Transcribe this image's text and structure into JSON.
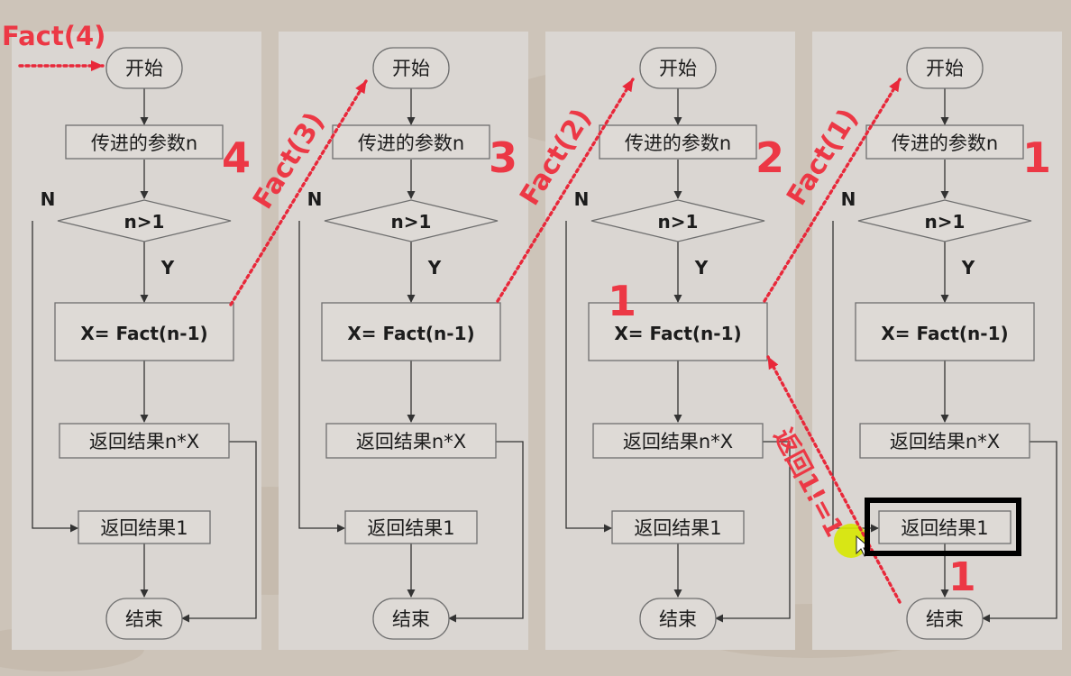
{
  "panels": [
    {
      "start": "开始",
      "param": "传进的参数n",
      "cond": "n>1",
      "no": "N",
      "yes": "Y",
      "call": "X= Fact(n-1)",
      "ret_nx": "返回结果n*X",
      "ret_1": "返回结果1",
      "end": "结束",
      "param_value": "4",
      "call_result": ""
    },
    {
      "start": "开始",
      "param": "传进的参数n",
      "cond": "n>1",
      "no": "N",
      "yes": "Y",
      "call": "X= Fact(n-1)",
      "ret_nx": "返回结果n*X",
      "ret_1": "返回结果1",
      "end": "结束",
      "param_value": "3",
      "call_result": ""
    },
    {
      "start": "开始",
      "param": "传进的参数n",
      "cond": "n>1",
      "no": "N",
      "yes": "Y",
      "call": "X= Fact(n-1)",
      "ret_nx": "返回结果n*X",
      "ret_1": "返回结果1",
      "end": "结束",
      "param_value": "2",
      "call_result": "1"
    },
    {
      "start": "开始",
      "param": "传进的参数n",
      "cond": "n>1",
      "no": "N",
      "yes": "Y",
      "call": "X= Fact(n-1)",
      "ret_nx": "返回结果n*X",
      "ret_1": "返回结果1",
      "end": "结束",
      "param_value": "1",
      "call_result": ""
    }
  ],
  "annotations": {
    "call_labels": [
      "Fact(4)",
      "Fact(3)",
      "Fact(2)",
      "Fact(1)"
    ],
    "return_label": "返回1!=1",
    "return_value": "1"
  },
  "colors": {
    "annotation": "#ec3845",
    "highlight_box": "#000000",
    "cursor_halo": "#d7e800"
  }
}
